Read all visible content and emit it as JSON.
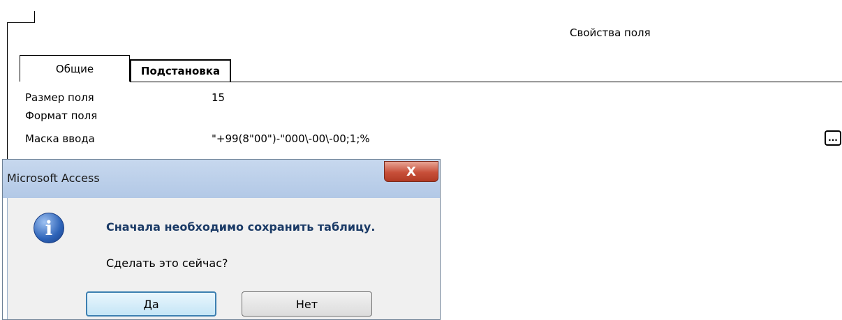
{
  "field_properties": {
    "title": "Свойства поля",
    "tabs": [
      {
        "label": "Общие"
      },
      {
        "label": "Подстановка"
      }
    ],
    "properties": [
      {
        "label": "Размер поля",
        "value": "15"
      },
      {
        "label": "Формат поля",
        "value": ""
      },
      {
        "label": "Маска ввода",
        "value": "\"+99(8\"00\")-\"000\\-00\\-00;1;%"
      }
    ],
    "builder_button_label": "..."
  },
  "dialog": {
    "title": "Microsoft Access",
    "close_label": "X",
    "icon": "info-icon",
    "message": "Сначала необходимо сохранить таблицу.",
    "question": "Сделать это сейчас?",
    "buttons": {
      "yes": "Да",
      "no": "Нет"
    }
  }
}
